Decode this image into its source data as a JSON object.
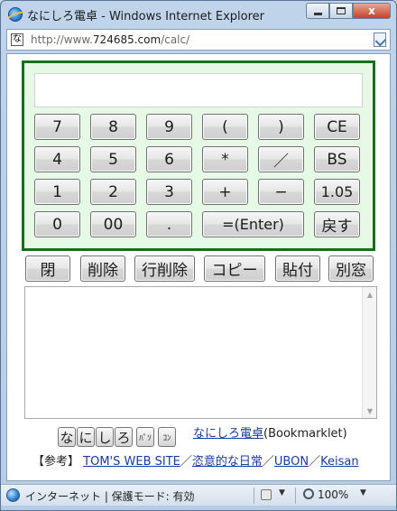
{
  "window": {
    "title": "なにしろ電卓 - Windows Internet Explorer",
    "close_glyph": "x"
  },
  "address": {
    "site_icon_glyph": "な",
    "url_prefix": "http://www.",
    "url_domain": "724685.com",
    "url_suffix": "/calc/"
  },
  "calculator": {
    "display_value": "",
    "keys": [
      {
        "label": "7",
        "name": "key-7"
      },
      {
        "label": "8",
        "name": "key-8"
      },
      {
        "label": "9",
        "name": "key-9"
      },
      {
        "label": "(",
        "name": "key-open-paren"
      },
      {
        "label": ")",
        "name": "key-close-paren"
      },
      {
        "label": "CE",
        "name": "key-clear-entry"
      },
      {
        "label": "4",
        "name": "key-4"
      },
      {
        "label": "5",
        "name": "key-5"
      },
      {
        "label": "6",
        "name": "key-6"
      },
      {
        "label": "*",
        "name": "key-multiply"
      },
      {
        "label": "／",
        "name": "key-divide"
      },
      {
        "label": "BS",
        "name": "key-backspace"
      },
      {
        "label": "1",
        "name": "key-1"
      },
      {
        "label": "2",
        "name": "key-2"
      },
      {
        "label": "3",
        "name": "key-3"
      },
      {
        "label": "+",
        "name": "key-plus"
      },
      {
        "label": "−",
        "name": "key-minus"
      },
      {
        "label": "1.05",
        "name": "key-tax"
      },
      {
        "label": "0",
        "name": "key-0"
      },
      {
        "label": "00",
        "name": "key-00"
      },
      {
        "label": ".",
        "name": "key-decimal"
      },
      {
        "label": "=(Enter)",
        "name": "key-equals",
        "wide": true
      },
      {
        "label": "戻す",
        "name": "key-undo"
      }
    ],
    "actions": [
      {
        "label": "閉",
        "name": "close-button"
      },
      {
        "label": "削除",
        "name": "delete-button"
      },
      {
        "label": "行削除",
        "name": "delete-line-button"
      },
      {
        "label": "コピー",
        "name": "copy-button"
      },
      {
        "label": "貼付",
        "name": "paste-button"
      },
      {
        "label": "別窓",
        "name": "new-window-button"
      }
    ],
    "history_text": ""
  },
  "bookmarklet": {
    "buttons": [
      "な",
      "に",
      "し",
      "ろ",
      "ﾊﾟｿ",
      "ｺﾝ"
    ],
    "link_text": "なにしろ電卓",
    "suffix": "(Bookmarklet)"
  },
  "references": {
    "prefix": "【参考】",
    "links": [
      "TOM'S WEB SITE",
      "恣意的な日常",
      "UBON",
      "Keisan"
    ],
    "separator": "／"
  },
  "statusbar": {
    "zone_text": "インターネット | 保護モード: 有効",
    "zoom": "100%"
  }
}
